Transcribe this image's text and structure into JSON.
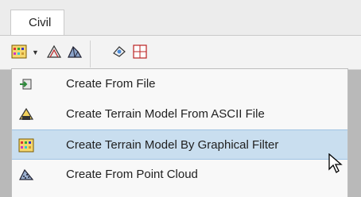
{
  "tab": {
    "label": "Civil"
  },
  "ribbon": {
    "icons": [
      "terrain-filter-icon",
      "dropdown-arrow-icon",
      "terrain-file-icon",
      "terrain-model-icon",
      "view-icon",
      "chart-icon"
    ]
  },
  "menu": {
    "items": [
      {
        "label": "Create From File",
        "icon": "import-file-icon"
      },
      {
        "label": "Create Terrain Model From ASCII File",
        "icon": "ascii-file-icon"
      },
      {
        "label": "Create Terrain Model By Graphical Filter",
        "icon": "graphical-filter-icon"
      },
      {
        "label": "Create From Point Cloud",
        "icon": "point-cloud-icon"
      }
    ],
    "highlighted_index": 2,
    "highlight_color": "#c9deef"
  }
}
